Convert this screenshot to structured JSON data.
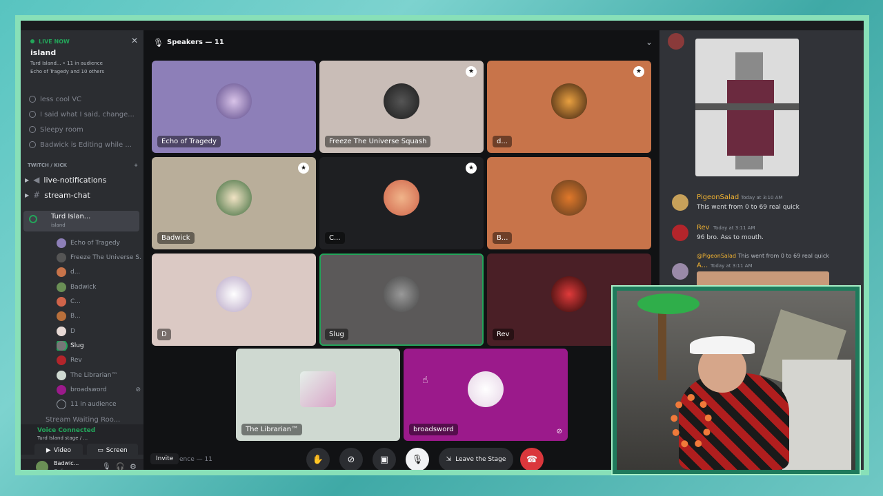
{
  "sidebar": {
    "live_label": "LIVE NOW",
    "live_title": "island",
    "live_sub1": "Turd Island... • 11 in audience",
    "live_sub2": "Echo of Tragedy and 10 others",
    "channels": [
      "less cool VC",
      "I said what I said, change...",
      "Sleepy room",
      "Badwick is Editing while ..."
    ],
    "category": "TWITCH / KICK",
    "text_channels": [
      "live-notifications",
      "stream-chat"
    ],
    "stage_name": "Turd Islan...",
    "stage_sub": "island",
    "members": [
      "Echo of Tragedy",
      "Freeze The Universe S...",
      "d...",
      "Badwick",
      "C...",
      "B...",
      "D",
      "Slug",
      "Rev",
      "The Librarian™",
      "broadsword"
    ],
    "audience": "11 in audience",
    "more_channel": "Stream Waiting Roo...",
    "voice_connected": "Voice Connected",
    "voice_sub": "Turd Island stage / ...",
    "video_btn": "Video",
    "screen_btn": "Screen",
    "user_name": "Badwic...",
    "user_status": "Online"
  },
  "stage": {
    "title": "Speakers — 11",
    "tiles": [
      {
        "name": "Echo of Tragedy",
        "bg": "#8d7fb8",
        "mod": false
      },
      {
        "name": "Freeze The Universe Squash",
        "bg": "#c9bdb7",
        "mod": true
      },
      {
        "name": "d...",
        "bg": "#c8744a",
        "mod": true
      },
      {
        "name": "Badwick",
        "bg": "#b9ae9a",
        "mod": true
      },
      {
        "name": "C...",
        "bg": "#1e1f22",
        "mod": true
      },
      {
        "name": "B...",
        "bg": "#c8744a",
        "mod": false
      },
      {
        "name": "D",
        "bg": "#dbc9c4",
        "mod": false
      },
      {
        "name": "Slug",
        "bg": "#5b5959",
        "mod": false
      },
      {
        "name": "Rev",
        "bg": "#4a1f26",
        "mod": false
      },
      {
        "name": "The Librarian™",
        "bg": "#cfd9d1",
        "mod": false
      },
      {
        "name": "broadsword",
        "bg": "#9b1a8b",
        "mod": false
      }
    ],
    "invite": "Invite",
    "audience": "ence — 11",
    "leave": "Leave the Stage"
  },
  "chat": {
    "messages": [
      {
        "user": "PigeonSalad",
        "time": "Today at 3:10 AM",
        "text": "This went from 0 to 69 real quick",
        "color": "#f0b232"
      },
      {
        "user": "Rev",
        "time": "Today at 3:11 AM",
        "text": "96 bro. Ass to mouth.",
        "color": "#f0b232"
      },
      {
        "user": "A...",
        "time": "Today at 3:11 AM",
        "text": "",
        "color": "#f0b232"
      }
    ],
    "reply_user": "@PigeonSalad",
    "reply_text": "This went from 0 to 69 real quick"
  }
}
